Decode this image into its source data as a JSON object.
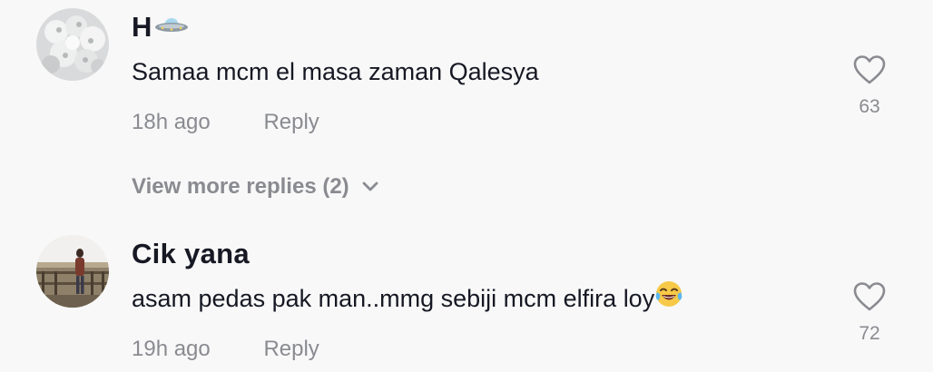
{
  "comments": [
    {
      "username": "H",
      "username_emoji": "ufo-icon",
      "text": "Samaa mcm el masa zaman Qalesya",
      "time": "18h ago",
      "reply_label": "Reply",
      "likes": "63"
    },
    {
      "username": "Cik yana",
      "text": "asam pedas pak man..mmg sebiji mcm elfira loy",
      "text_emoji": "tears-of-joy-emoji",
      "time": "19h ago",
      "reply_label": "Reply",
      "likes": "72"
    }
  ],
  "view_more_label": "View more replies (2)",
  "icons": {
    "like": "heart-outline-icon",
    "expand": "chevron-down-icon"
  },
  "colors": {
    "background": "#f8f8f8",
    "text_primary": "#161823",
    "text_secondary": "#8a8b91"
  }
}
